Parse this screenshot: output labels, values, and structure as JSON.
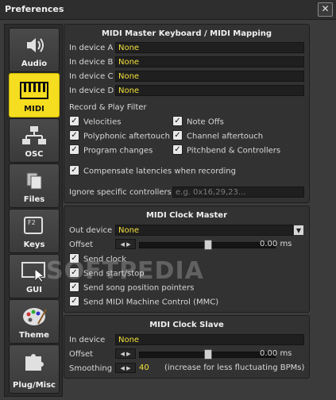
{
  "window": {
    "title": "Preferences",
    "close_glyph": "✕"
  },
  "sidebar": {
    "items": [
      {
        "label": "Audio",
        "icon": "speaker-icon",
        "active": false
      },
      {
        "label": "MIDI",
        "icon": "piano-keys-icon",
        "active": true
      },
      {
        "label": "OSC",
        "icon": "network-icon",
        "active": false
      },
      {
        "label": "Files",
        "icon": "files-icon",
        "active": false
      },
      {
        "label": "Keys",
        "icon": "keyboard-key-icon",
        "active": false
      },
      {
        "label": "GUI",
        "icon": "gui-cursor-icon",
        "active": false
      },
      {
        "label": "Theme",
        "icon": "palette-icon",
        "active": false
      },
      {
        "label": "Plug/Misc",
        "icon": "puzzle-icon",
        "active": false
      }
    ],
    "keys_icon_text": "F2"
  },
  "mapping": {
    "title": "MIDI Master Keyboard / MIDI Mapping",
    "devices": [
      {
        "label": "In device A",
        "value": "None"
      },
      {
        "label": "In device B",
        "value": "None"
      },
      {
        "label": "In device C",
        "value": "None"
      },
      {
        "label": "In device D",
        "value": "None"
      }
    ],
    "filter_title": "Record & Play Filter",
    "filters": [
      {
        "label": "Velocities",
        "checked": true
      },
      {
        "label": "Note Offs",
        "checked": true
      },
      {
        "label": "Polyphonic aftertouch",
        "checked": true
      },
      {
        "label": "Channel aftertouch",
        "checked": true
      },
      {
        "label": "Program changes",
        "checked": true
      },
      {
        "label": "Pitchbend & Controllers",
        "checked": true
      }
    ],
    "compensate": {
      "label": "Compensate latencies when recording",
      "checked": true
    },
    "ignore_label": "Ignore specific controllers",
    "ignore_placeholder": "e.g. 0x16,29,23..."
  },
  "clock_master": {
    "title": "MIDI Clock Master",
    "out_label": "Out device",
    "out_value": "None",
    "offset_label": "Offset",
    "offset_value": "0.00 ms",
    "offset_level": 0.5,
    "options": [
      {
        "label": "Send clock",
        "checked": true
      },
      {
        "label": "Send start/stop",
        "checked": true
      },
      {
        "label": "Send song position pointers",
        "checked": true
      },
      {
        "label": "Send MIDI Machine Control (MMC)",
        "checked": true
      }
    ]
  },
  "clock_slave": {
    "title": "MIDI Clock Slave",
    "in_label": "In device",
    "in_value": "None",
    "offset_label": "Offset",
    "offset_value": "0.00 ms",
    "offset_level": 0.5,
    "smoothing_label": "Smoothing",
    "smoothing_value": "40",
    "smoothing_hint": "(increase for less fluctuating BPMs)"
  },
  "spinner_glyph": "◀ ▶",
  "check_glyph": "✓",
  "dropdown_glyph": "▼",
  "watermark": "SOFTPEDIA",
  "colors": {
    "accent": "#f5dd1f",
    "value_text": "#f4e13a"
  }
}
